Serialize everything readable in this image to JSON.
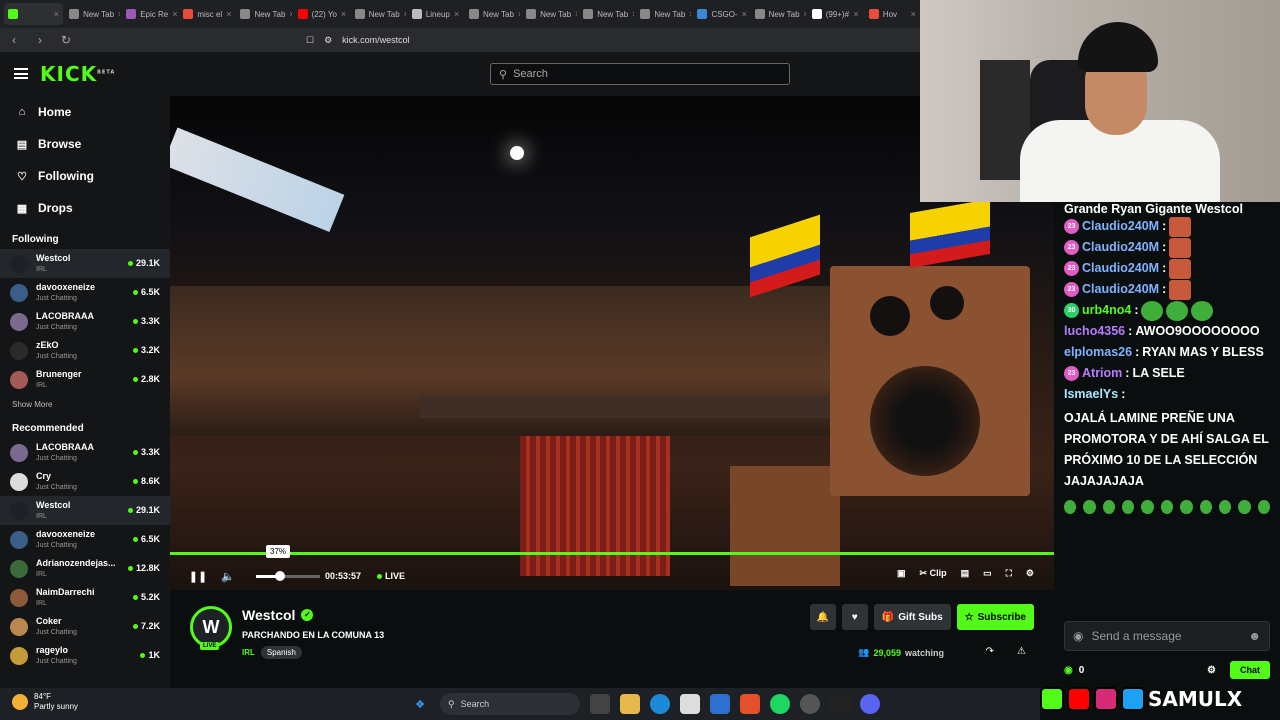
{
  "browser": {
    "tabs": [
      "",
      "New Tab",
      "Epic Re",
      "misc el",
      "New Tab",
      "(22) Yo",
      "New Tab",
      "Lineup",
      "New Tab",
      "New Tab",
      "New Tab",
      "New Tab",
      "CSGO-",
      "New Tab",
      "(99+)#",
      "Hov"
    ],
    "url": "kick.com/westcol"
  },
  "header": {
    "logo": "KICK",
    "logo_sup": "BETA",
    "search_placeholder": "Search"
  },
  "sidebar": {
    "nav": [
      {
        "label": "Home",
        "icon": "home-icon"
      },
      {
        "label": "Browse",
        "icon": "browse-icon"
      },
      {
        "label": "Following",
        "icon": "heart-icon"
      },
      {
        "label": "Drops",
        "icon": "drops-icon"
      }
    ],
    "following_title": "Following",
    "following": [
      {
        "name": "Westcol",
        "category": "IRL",
        "viewers": "29.1K",
        "color": "#1e2226"
      },
      {
        "name": "davooxeneize",
        "category": "Just Chatting",
        "viewers": "6.5K",
        "color": "#3a5d8a"
      },
      {
        "name": "LACOBRAAA",
        "category": "Just Chatting",
        "viewers": "3.3K",
        "color": "#7a6a8f"
      },
      {
        "name": "zEkO",
        "category": "Just Chatting",
        "viewers": "3.2K",
        "color": "#2a2a2a"
      },
      {
        "name": "Brunenger",
        "category": "IRL",
        "viewers": "2.8K",
        "color": "#a55a5a"
      }
    ],
    "show_more": "Show More",
    "recommended_title": "Recommended",
    "recommended": [
      {
        "name": "LACOBRAAA",
        "category": "Just Chatting",
        "viewers": "3.3K",
        "color": "#7a6a8f"
      },
      {
        "name": "Cry",
        "category": "Just Chatting",
        "viewers": "8.6K",
        "color": "#dcdcdc"
      },
      {
        "name": "Westcol",
        "category": "IRL",
        "viewers": "29.1K",
        "color": "#1e2226"
      },
      {
        "name": "davooxeneize",
        "category": "Just Chatting",
        "viewers": "6.5K",
        "color": "#3a5d8a"
      },
      {
        "name": "Adrianozendejas...",
        "category": "IRL",
        "viewers": "12.8K",
        "color": "#3a6a3a"
      },
      {
        "name": "NaimDarrechi",
        "category": "IRL",
        "viewers": "5.2K",
        "color": "#8a5a3a"
      },
      {
        "name": "Coker",
        "category": "Just Chatting",
        "viewers": "7.2K",
        "color": "#b9884f"
      },
      {
        "name": "rageylo",
        "category": "Just Chatting",
        "viewers": "1K",
        "color": "#c49a3a"
      }
    ]
  },
  "player": {
    "volume_tooltip": "37%",
    "volume": 0.37,
    "time": "00:53:57",
    "live": "LIVE",
    "clip": "Clip"
  },
  "channel": {
    "name": "Westcol",
    "avatar_letter": "W",
    "live_badge": "LIVE",
    "title": "PARCHANDO EN LA COMUNA 13",
    "category": "IRL",
    "tag": "Spanish",
    "gift": "Gift Subs",
    "subscribe": "Subscribe",
    "watching_count": "29,059",
    "watching_label": "watching"
  },
  "chat": {
    "top_cut": "Grande Ryan Gigante Westcol",
    "messages": [
      {
        "badge": "23",
        "user": "Claudio240M",
        "text": "",
        "emote": "face",
        "ucls": "blue"
      },
      {
        "badge": "23",
        "user": "Claudio240M",
        "text": "",
        "emote": "face",
        "ucls": "blue"
      },
      {
        "badge": "23",
        "user": "Claudio240M",
        "text": "",
        "emote": "face",
        "ucls": "blue"
      },
      {
        "badge": "23",
        "user": "Claudio240M",
        "text": "",
        "emote": "face",
        "ucls": "blue"
      },
      {
        "badge": "30",
        "user": "urb4no4",
        "text": "",
        "emote": "pepe3",
        "ucls": "green",
        "bcls": "gr"
      },
      {
        "badge": "",
        "user": "lucho4356",
        "text": "AWOO9OOOOOOOO",
        "ucls": ""
      },
      {
        "badge": "",
        "user": "elplomas26",
        "text": "RYAN MAS Y BLESS",
        "ucls": "blue"
      },
      {
        "badge": "23",
        "user": "Atriom",
        "text": "LA SELE",
        "ucls": ""
      },
      {
        "badge": "",
        "user": "IsmaelYs",
        "text": "OJALÁ LAMINE PREÑE UNA PROMOTORA Y DE AHÍ SALGA EL PRÓXIMO 10 DE LA SELECCIÓN JAJAJAJAJA",
        "ucls": "cyan"
      }
    ],
    "input_placeholder": "Send a message",
    "points": "0",
    "chat_button": "Chat"
  },
  "overlay_text": "SAMULX",
  "taskbar": {
    "temp": "84°F",
    "weather": "Partly sunny",
    "search": "Search"
  }
}
